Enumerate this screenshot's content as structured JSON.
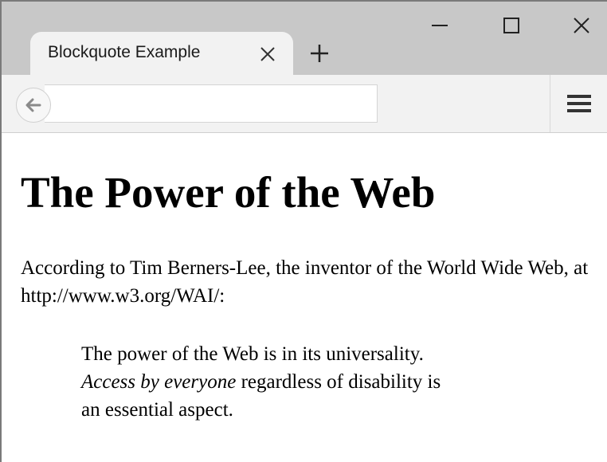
{
  "window": {
    "tab_title": "Blockquote Example",
    "controls": [
      "minimize-icon",
      "maximize-icon",
      "close-icon"
    ]
  },
  "navbar": {
    "url_value": "",
    "icons": [
      "back-arrow-icon",
      "hamburger-menu-icon"
    ]
  },
  "page": {
    "heading": "The Power of the Web",
    "intro": "According to Tim Berners-Lee, the inventor of the World Wide Web, at http://www.w3.org/WAI/:",
    "quote": {
      "line1": "The power of the Web is in its universality.",
      "emphasis": "Access by everyone",
      "line2_rest": " regardless of disability is",
      "line3": "an essential aspect."
    }
  },
  "colors": {
    "tabstrip": "#c8c8c8",
    "toolbar": "#f2f2f2",
    "page_background": "#ffffff",
    "text": "#000000"
  }
}
